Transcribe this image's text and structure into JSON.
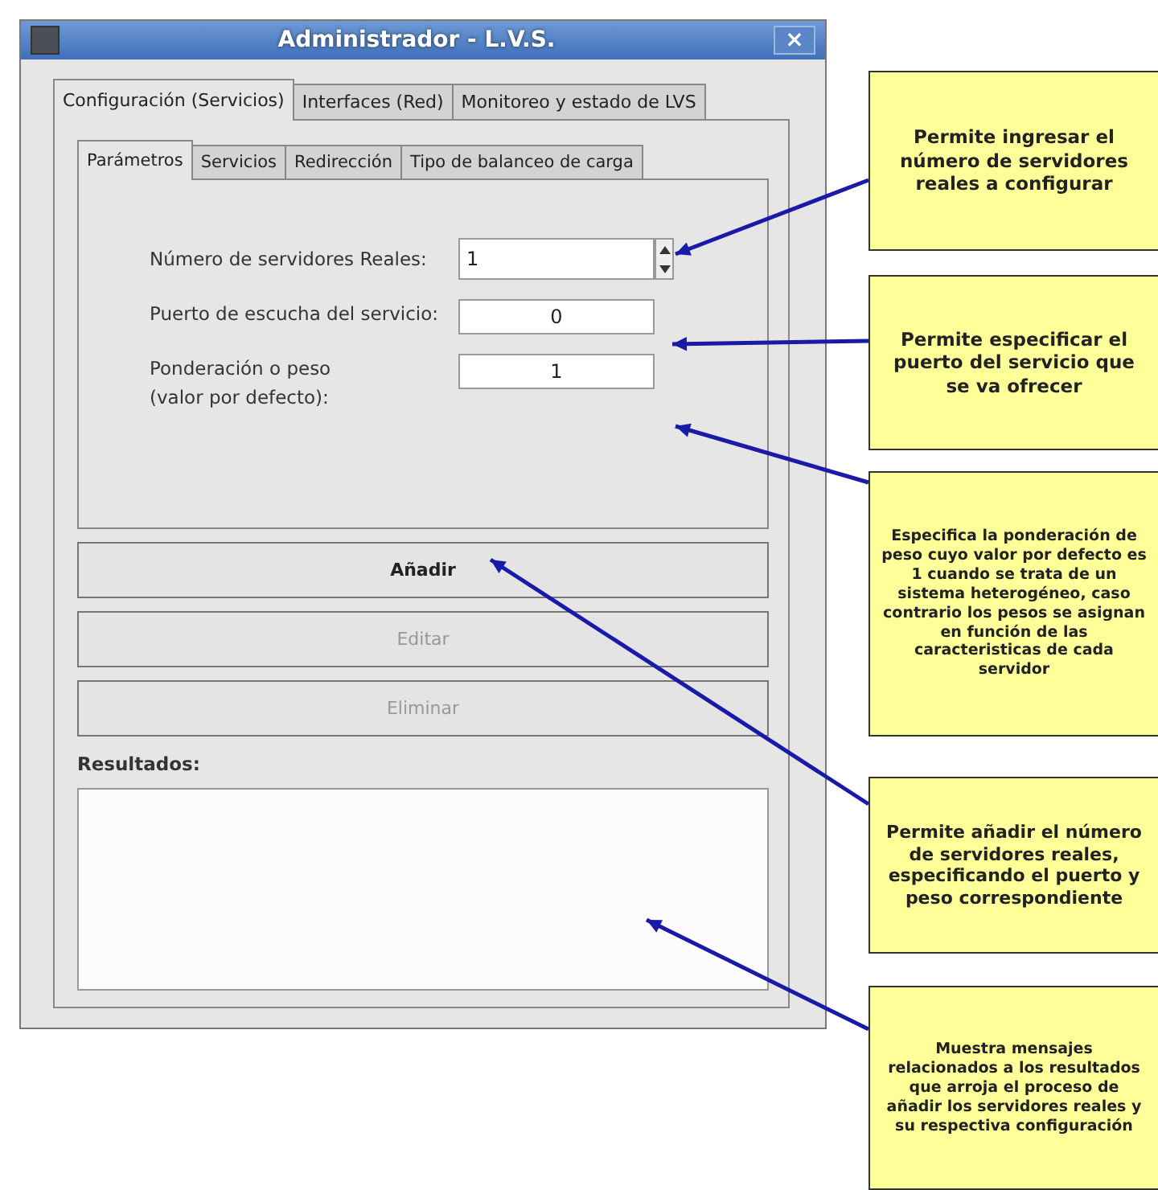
{
  "window": {
    "title": "Administrador - L.V.S.",
    "close": "×"
  },
  "tabs": [
    {
      "label": "Configuración (Servicios)",
      "selected": true
    },
    {
      "label": "Interfaces (Red)",
      "selected": false
    },
    {
      "label": "Monitoreo y estado de LVS",
      "selected": false
    }
  ],
  "subtabs": [
    {
      "label": "Parámetros",
      "selected": true
    },
    {
      "label": "Servicios",
      "selected": false
    },
    {
      "label": "Redirección",
      "selected": false
    },
    {
      "label": "Tipo de balanceo de carga",
      "selected": false
    }
  ],
  "fields": [
    {
      "kind": "spinner",
      "label": "Número de servidores Reales:",
      "value": "1"
    },
    {
      "kind": "text",
      "label": "Puerto de escucha del servicio:",
      "value": "0"
    },
    {
      "kind": "text",
      "label": "Ponderación o peso\n(valor por defecto):",
      "value": "1"
    }
  ],
  "buttons": [
    {
      "label": "Añadir",
      "disabled": false
    },
    {
      "label": "Editar",
      "disabled": true
    },
    {
      "label": "Eliminar",
      "disabled": true
    }
  ],
  "results": {
    "label": "Resultados:"
  },
  "callouts": [
    {
      "text": "Permite ingresar el número de servidores reales a configurar"
    },
    {
      "text": "Permite especificar el puerto del servicio que se va ofrecer"
    },
    {
      "text": "Especifica la ponderación de peso cuyo valor por defecto es 1 cuando se trata de un sistema heterogéneo, caso contrario los pesos se asignan en función de las caracteristicas de cada servidor"
    },
    {
      "text": "Permite añadir el número de servidores reales, especificando el puerto y peso correspondiente"
    },
    {
      "text": "Muestra mensajes relacionados a los resultados que arroja el proceso de añadir los servidores reales y su respectiva configuración"
    }
  ]
}
